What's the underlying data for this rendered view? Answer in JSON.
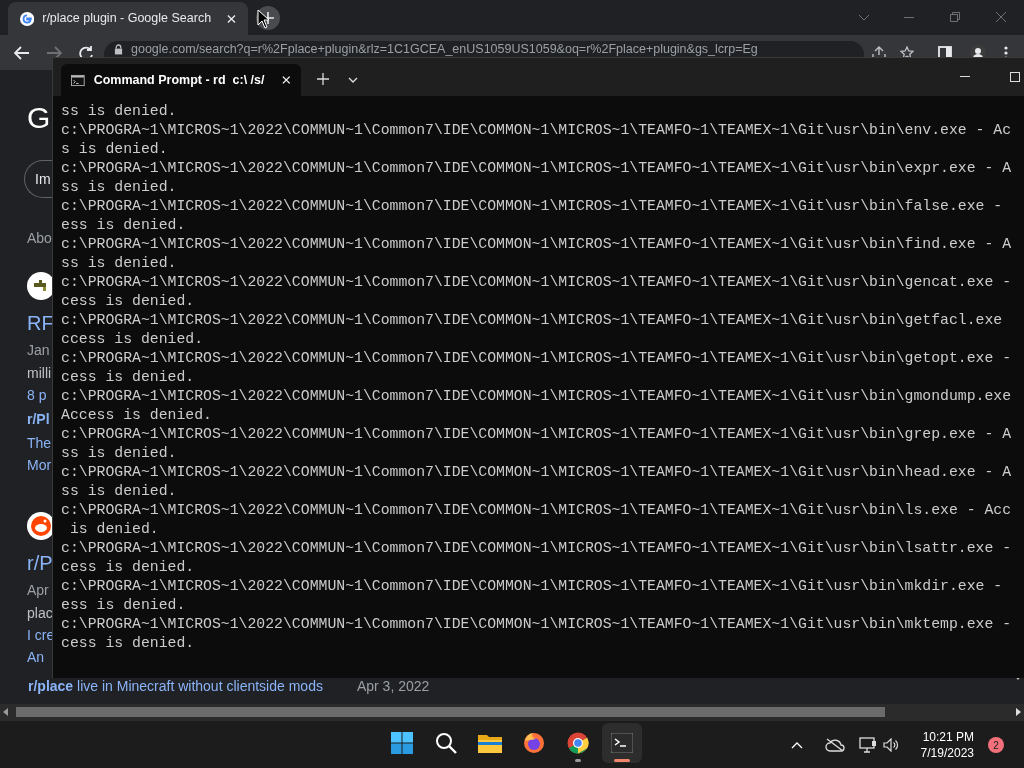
{
  "browser": {
    "tab_title": "r/place plugin - Google Search",
    "address": "google.com/search?q=r%2Fplace+plugin&rlz=1C1GCEA_enUS1059US1059&oq=r%2Fplace+plugin&gs_lcrp=Eg",
    "fragments": [
      {
        "kind": "logo",
        "text": "G"
      },
      {
        "kind": "chip",
        "text": "Im"
      },
      {
        "kind": "about",
        "text": "Abo"
      },
      {
        "kind": "favicon-tap"
      },
      {
        "kind": "title",
        "text": "RF"
      },
      {
        "kind": "meta",
        "text": "Jan"
      },
      {
        "kind": "text",
        "text": "milli"
      },
      {
        "kind": "link",
        "text": "8 p"
      },
      {
        "kind": "boldlink",
        "text": "r/Pl"
      },
      {
        "kind": "link",
        "text": "The"
      },
      {
        "kind": "link",
        "text": "Mor"
      },
      {
        "kind": "favicon-reddit"
      },
      {
        "kind": "title",
        "text": "r/P"
      },
      {
        "kind": "meta",
        "text": "Apr"
      },
      {
        "kind": "text",
        "text": "plac"
      },
      {
        "kind": "link",
        "text": "I cre"
      },
      {
        "kind": "link",
        "text": "An"
      }
    ],
    "last_link": "**r/place** live in Minecraft without clientside mods",
    "last_date": "Apr 3, 2022"
  },
  "terminal": {
    "tab_title": "Command Prompt - rd  c:\\ /s/",
    "lines": [
      "ss is denied.",
      "c:\\PROGRA~1\\MICROS~1\\2022\\COMMUN~1\\Common7\\IDE\\COMMON~1\\MICROS~1\\TEAMFO~1\\TEAMEX~1\\Git\\usr\\bin\\env.exe - Ac",
      "s is denied.",
      "c:\\PROGRA~1\\MICROS~1\\2022\\COMMUN~1\\Common7\\IDE\\COMMON~1\\MICROS~1\\TEAMFO~1\\TEAMEX~1\\Git\\usr\\bin\\expr.exe - A",
      "ss is denied.",
      "c:\\PROGRA~1\\MICROS~1\\2022\\COMMUN~1\\Common7\\IDE\\COMMON~1\\MICROS~1\\TEAMFO~1\\TEAMEX~1\\Git\\usr\\bin\\false.exe -",
      "ess is denied.",
      "c:\\PROGRA~1\\MICROS~1\\2022\\COMMUN~1\\Common7\\IDE\\COMMON~1\\MICROS~1\\TEAMFO~1\\TEAMEX~1\\Git\\usr\\bin\\find.exe - A",
      "ss is denied.",
      "c:\\PROGRA~1\\MICROS~1\\2022\\COMMUN~1\\Common7\\IDE\\COMMON~1\\MICROS~1\\TEAMFO~1\\TEAMEX~1\\Git\\usr\\bin\\gencat.exe -",
      "cess is denied.",
      "c:\\PROGRA~1\\MICROS~1\\2022\\COMMUN~1\\Common7\\IDE\\COMMON~1\\MICROS~1\\TEAMFO~1\\TEAMEX~1\\Git\\usr\\bin\\getfacl.exe",
      "ccess is denied.",
      "c:\\PROGRA~1\\MICROS~1\\2022\\COMMUN~1\\Common7\\IDE\\COMMON~1\\MICROS~1\\TEAMFO~1\\TEAMEX~1\\Git\\usr\\bin\\getopt.exe -",
      "cess is denied.",
      "c:\\PROGRA~1\\MICROS~1\\2022\\COMMUN~1\\Common7\\IDE\\COMMON~1\\MICROS~1\\TEAMFO~1\\TEAMEX~1\\Git\\usr\\bin\\gmondump.exe",
      "Access is denied.",
      "c:\\PROGRA~1\\MICROS~1\\2022\\COMMUN~1\\Common7\\IDE\\COMMON~1\\MICROS~1\\TEAMFO~1\\TEAMEX~1\\Git\\usr\\bin\\grep.exe - A",
      "ss is denied.",
      "c:\\PROGRA~1\\MICROS~1\\2022\\COMMUN~1\\Common7\\IDE\\COMMON~1\\MICROS~1\\TEAMFO~1\\TEAMEX~1\\Git\\usr\\bin\\head.exe - A",
      "ss is denied.",
      "c:\\PROGRA~1\\MICROS~1\\2022\\COMMUN~1\\Common7\\IDE\\COMMON~1\\MICROS~1\\TEAMFO~1\\TEAMEX~1\\Git\\usr\\bin\\ls.exe - Acc",
      " is denied.",
      "c:\\PROGRA~1\\MICROS~1\\2022\\COMMUN~1\\Common7\\IDE\\COMMON~1\\MICROS~1\\TEAMFO~1\\TEAMEX~1\\Git\\usr\\bin\\lsattr.exe -",
      "cess is denied.",
      "c:\\PROGRA~1\\MICROS~1\\2022\\COMMUN~1\\Common7\\IDE\\COMMON~1\\MICROS~1\\TEAMFO~1\\TEAMEX~1\\Git\\usr\\bin\\mkdir.exe -",
      "ess is denied.",
      "c:\\PROGRA~1\\MICROS~1\\2022\\COMMUN~1\\Common7\\IDE\\COMMON~1\\MICROS~1\\TEAMFO~1\\TEAMEX~1\\Git\\usr\\bin\\mktemp.exe -",
      "cess is denied."
    ]
  },
  "taskbar": {
    "apps": [
      {
        "kind": "start",
        "active": false
      },
      {
        "kind": "search",
        "active": false
      },
      {
        "kind": "files",
        "active": false
      },
      {
        "kind": "firefox",
        "active": false
      },
      {
        "kind": "chrome",
        "active": false,
        "running": true
      },
      {
        "kind": "terminal",
        "active": true
      }
    ],
    "time": "10:21 PM",
    "date": "7/19/2023",
    "notifications": "2"
  }
}
